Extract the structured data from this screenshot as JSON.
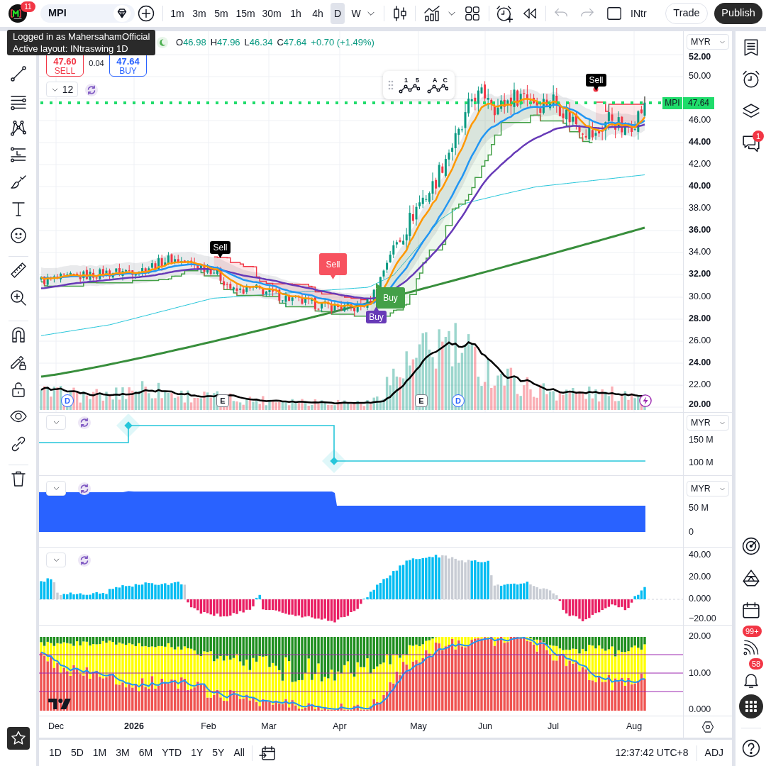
{
  "header": {
    "logo_badge": "11",
    "symbol": "MPI",
    "intervals": [
      {
        "label": "1m",
        "selected": false
      },
      {
        "label": "3m",
        "selected": false
      },
      {
        "label": "5m",
        "selected": false
      },
      {
        "label": "15m",
        "selected": false
      },
      {
        "label": "30m",
        "selected": false
      },
      {
        "label": "1h",
        "selected": false
      },
      {
        "label": "4h",
        "selected": false
      },
      {
        "label": "D",
        "selected": true
      },
      {
        "label": "W",
        "selected": false
      }
    ],
    "layout_name": "INtr",
    "trade_button": "Trade",
    "publish_button": "Publish"
  },
  "tooltip": {
    "lines": [
      "Logged in as MahersahamOfficial",
      "Active layout: INtraswing 1D"
    ]
  },
  "legend": {
    "ohlc": [
      {
        "key": "O",
        "value": "46.98"
      },
      {
        "key": "H",
        "value": "47.96"
      },
      {
        "key": "L",
        "value": "46.34"
      },
      {
        "key": "C",
        "value": "47.64"
      }
    ],
    "change": "+0.70 (+1.49%)"
  },
  "order_panel": {
    "sell": {
      "price": "47.60",
      "label": "SELL"
    },
    "spread": "0.04",
    "buy": {
      "price": "47.64",
      "label": "BUY"
    }
  },
  "indicators_toggle": {
    "count": "12"
  },
  "wave_tools": [
    {
      "marks": [
        "1",
        "5"
      ]
    },
    {
      "marks": [
        "A",
        "C"
      ]
    }
  ],
  "signal_tags": [
    {
      "kind": "sell-dark",
      "text": "Sell"
    },
    {
      "kind": "sell-dark",
      "text": "Sell"
    },
    {
      "kind": "sell-red",
      "text": "Sell"
    },
    {
      "kind": "buy-green",
      "text": "Buy"
    },
    {
      "kind": "buy-purple",
      "text": "Buy"
    }
  ],
  "events": [
    {
      "kind": "dividend",
      "text": "D"
    },
    {
      "kind": "earnings",
      "text": "E"
    },
    {
      "kind": "earnings",
      "text": "E"
    },
    {
      "kind": "dividend",
      "text": "D"
    },
    {
      "kind": "flash"
    }
  ],
  "price_line": {
    "symbol": "MPI",
    "price": "47.64"
  },
  "price_axis": {
    "currency": "MYR",
    "ticks": [
      {
        "label": "52.00",
        "major": true
      },
      {
        "label": "50.00",
        "major": false
      },
      {
        "label": "46.00",
        "major": false
      },
      {
        "label": "44.00",
        "major": true
      },
      {
        "label": "42.00",
        "major": false
      },
      {
        "label": "40.00",
        "major": true
      },
      {
        "label": "38.00",
        "major": false
      },
      {
        "label": "36.00",
        "major": true
      },
      {
        "label": "34.00",
        "major": false
      },
      {
        "label": "32.00",
        "major": true
      },
      {
        "label": "30.00",
        "major": false
      },
      {
        "label": "28.00",
        "major": true
      },
      {
        "label": "26.00",
        "major": false
      },
      {
        "label": "24.00",
        "major": true
      },
      {
        "label": "22.00",
        "major": false
      },
      {
        "label": "20.00",
        "major": true
      }
    ]
  },
  "panes": [
    {
      "kind": "step-line",
      "controls": true,
      "currency": "MYR",
      "ticks": [
        "150 M",
        "100 M"
      ]
    },
    {
      "kind": "area",
      "controls": true,
      "currency": "MYR",
      "ticks": [
        "50 M",
        "0"
      ]
    },
    {
      "kind": "histogram",
      "controls": true,
      "ticks": [
        "40.00",
        "20.00",
        "0.000",
        "−20.00"
      ]
    },
    {
      "kind": "stacked-bars",
      "controls": false,
      "ticks": [
        "20.00",
        "10.00",
        "0.000"
      ]
    }
  ],
  "time_axis": {
    "labels": [
      {
        "text": "Dec",
        "major": false
      },
      {
        "text": "2026",
        "major": true
      },
      {
        "text": "Feb",
        "major": false
      },
      {
        "text": "Mar",
        "major": false
      },
      {
        "text": "Apr",
        "major": false
      },
      {
        "text": "May",
        "major": false
      },
      {
        "text": "Jun",
        "major": false
      },
      {
        "text": "Jul",
        "major": false
      },
      {
        "text": "Aug",
        "major": false
      }
    ]
  },
  "bottom_bar": {
    "ranges": [
      "1D",
      "5D",
      "1M",
      "3M",
      "6M",
      "YTD",
      "1Y",
      "5Y",
      "All"
    ],
    "clock": "12:37:42 UTC+8",
    "adjustment": "ADJ"
  },
  "right_toolbar": {
    "chat_badge": "1",
    "feed_badge": "99+",
    "alerts_badge": "58"
  }
}
